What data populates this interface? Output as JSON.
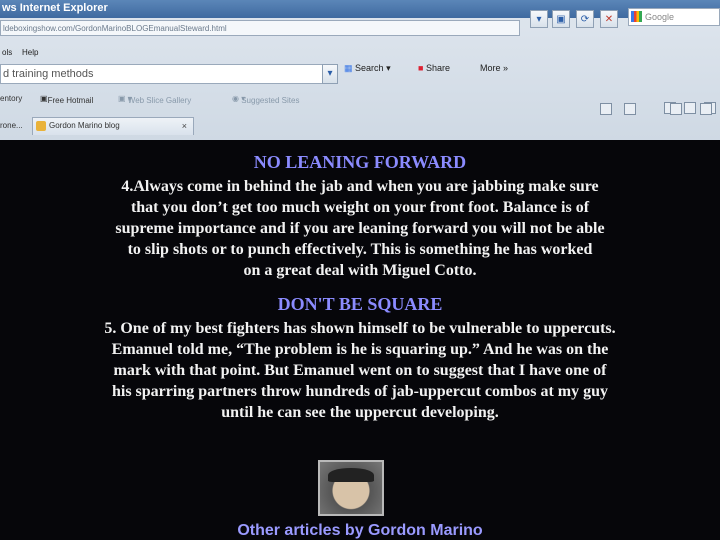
{
  "browser": {
    "window_title": "ws Internet Explorer",
    "address": "ldeboxingshow.com/GordonMarinoBLOGEmanualSteward.html",
    "search_box_text": "d training methods",
    "google_placeholder": "Google",
    "menu": [
      "ols",
      "Help"
    ],
    "toolbar": {
      "search_label": "Search",
      "share_label": "Share",
      "more_label": "More »"
    },
    "favorites": [
      "entory",
      "Free Hotmail",
      "Web Slice Gallery",
      "Suggested Sites"
    ],
    "tab_left_stub": "rone...",
    "tab_title": "Gordon Marino blog",
    "tab_close": "×"
  },
  "article": {
    "section4_heading": "NO LEANING FORWARD",
    "section4_lines": [
      "4.Always come in behind the jab and when you are jabbing make sure",
      "that you don’t get too much weight on your front foot. Balance is of",
      "supreme importance and if you are leaning forward you will not be able",
      "to slip shots or to punch effectively. This is something he has worked",
      "on a great deal with Miguel Cotto."
    ],
    "section5_heading": "DON'T BE SQUARE",
    "section5_lines": [
      "5. One of my best fighters has shown himself to be vulnerable to uppercuts.",
      "Emanuel told me, “The problem is he is squaring up.” And he was on the",
      "mark with that point. But Emanuel went on to suggest that I have one of",
      "his sparring partners throw hundreds of jab-uppercut combos at my guy",
      "until he can see the uppercut developing."
    ],
    "footer_link": "Other articles by Gordon Marino"
  }
}
